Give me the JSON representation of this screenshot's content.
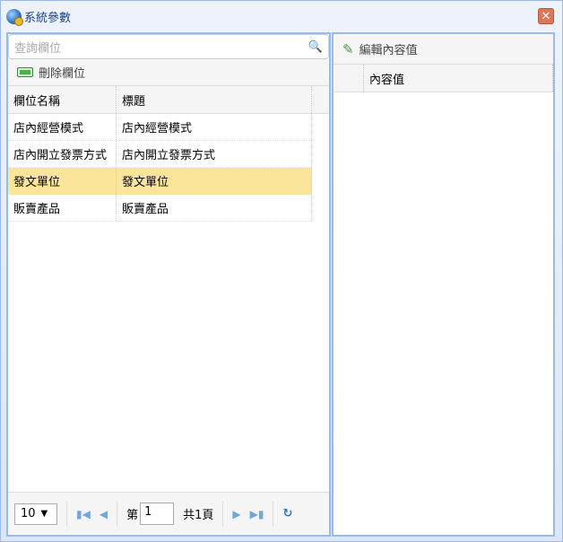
{
  "window": {
    "title": "系統參數",
    "close": "✕"
  },
  "left": {
    "search_placeholder": "查詢欄位",
    "delete_label": "刪除欄位",
    "columns": [
      "欄位名稱",
      "標題"
    ],
    "rows": [
      [
        "店內經營模式",
        "店內經營模式"
      ],
      [
        "店內開立發票方式",
        "店內開立發票方式"
      ],
      [
        "發文單位",
        "發文單位"
      ],
      [
        "販賣產品",
        "販賣產品"
      ]
    ],
    "pager": {
      "page_size": "10",
      "page_prefix": "第",
      "page": "1",
      "total": "共1頁"
    }
  },
  "right": {
    "edit_label": "編輯內容值",
    "column": "內容值"
  }
}
